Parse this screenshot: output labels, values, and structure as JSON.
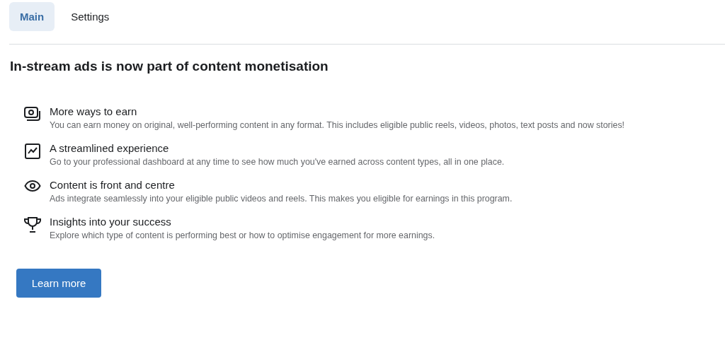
{
  "tabs": [
    {
      "label": "Main",
      "selected": true
    },
    {
      "label": "Settings",
      "selected": false
    }
  ],
  "heading": "In-stream ads is now part of content monetisation",
  "features": [
    {
      "kind": "money",
      "title": "More ways to earn",
      "description": "You can earn money on original, well-performing content in any format. This includes eligible public reels, videos, photos, text posts and now stories!"
    },
    {
      "kind": "chart",
      "title": "A streamlined experience",
      "description": "Go to your professional dashboard at any time to see how much you've earned across content types, all in one place."
    },
    {
      "kind": "eye",
      "title": "Content is front and centre",
      "description": "Ads integrate seamlessly into your eligible public videos and reels. This makes you eligible for earnings in this program."
    },
    {
      "kind": "trophy",
      "title": "Insights into your success",
      "description": "Explore which type of content is performing best or how to optimise engagement for more earnings."
    }
  ],
  "button": "Learn more"
}
